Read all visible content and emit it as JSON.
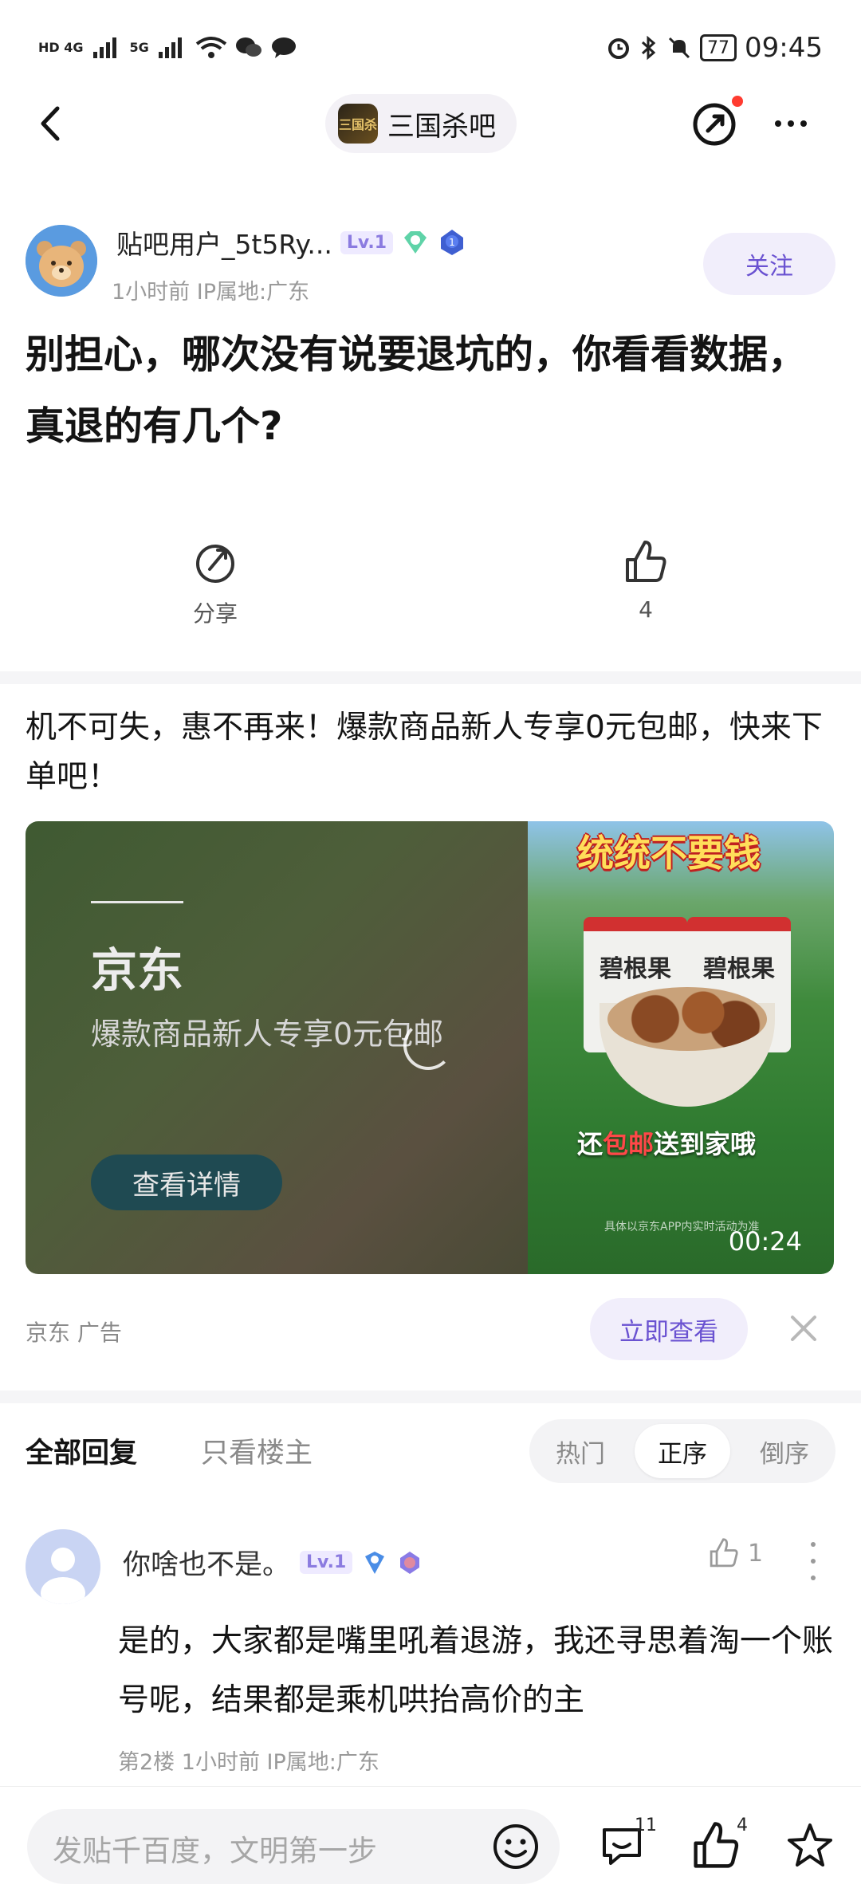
{
  "status_bar": {
    "network_left": "HD 4G",
    "network_right": "5G",
    "battery": "77",
    "time": "09:45"
  },
  "nav": {
    "forum_icon_text": "三国杀",
    "forum_name": "三国杀吧"
  },
  "post": {
    "author_name": "贴吧用户_5t5Ry...",
    "level": "Lv.1",
    "badge_num": "1",
    "meta": "1小时前    IP属地:广东",
    "follow_label": "关注",
    "title": "别担心，哪次没有说要退坑的，你看看数据，真退的有几个?",
    "share_label": "分享",
    "like_count": "4"
  },
  "ad": {
    "text": "机不可失，惠不再来！爆款商品新人专享0元包邮，快来下单吧！",
    "brand": "京东",
    "subtitle": "爆款商品新人专享0元包邮",
    "detail_button": "查看详情",
    "headline": "统统不要钱",
    "pack_label": "碧根果",
    "caption_pre": "还",
    "caption_red": "包邮",
    "caption_post": "送到家哦",
    "fine_print": "具体以京东APP内实时活动为准",
    "video_time": "00:24",
    "source": "京东  广告",
    "view_button": "立即查看"
  },
  "replies": {
    "tab_all": "全部回复",
    "tab_op": "只看楼主",
    "sort_hot": "热门",
    "sort_asc": "正序",
    "sort_desc": "倒序"
  },
  "comment": {
    "author": "你啥也不是。",
    "level": "Lv.1",
    "like_count": "1",
    "body": "是的，大家都是嘴里吼着退游，我还寻思着淘一个账号呢，结果都是乘机哄抬高价的主",
    "meta": "第2楼   1小时前   IP属地:广东"
  },
  "bottom_bar": {
    "placeholder": "发贴千百度，文明第一步",
    "comment_count": "11",
    "like_count": "4"
  },
  "colors": {
    "accent": "#6a52d1",
    "accent_bg": "#f1eefb",
    "divider": "#f5f5f7"
  }
}
